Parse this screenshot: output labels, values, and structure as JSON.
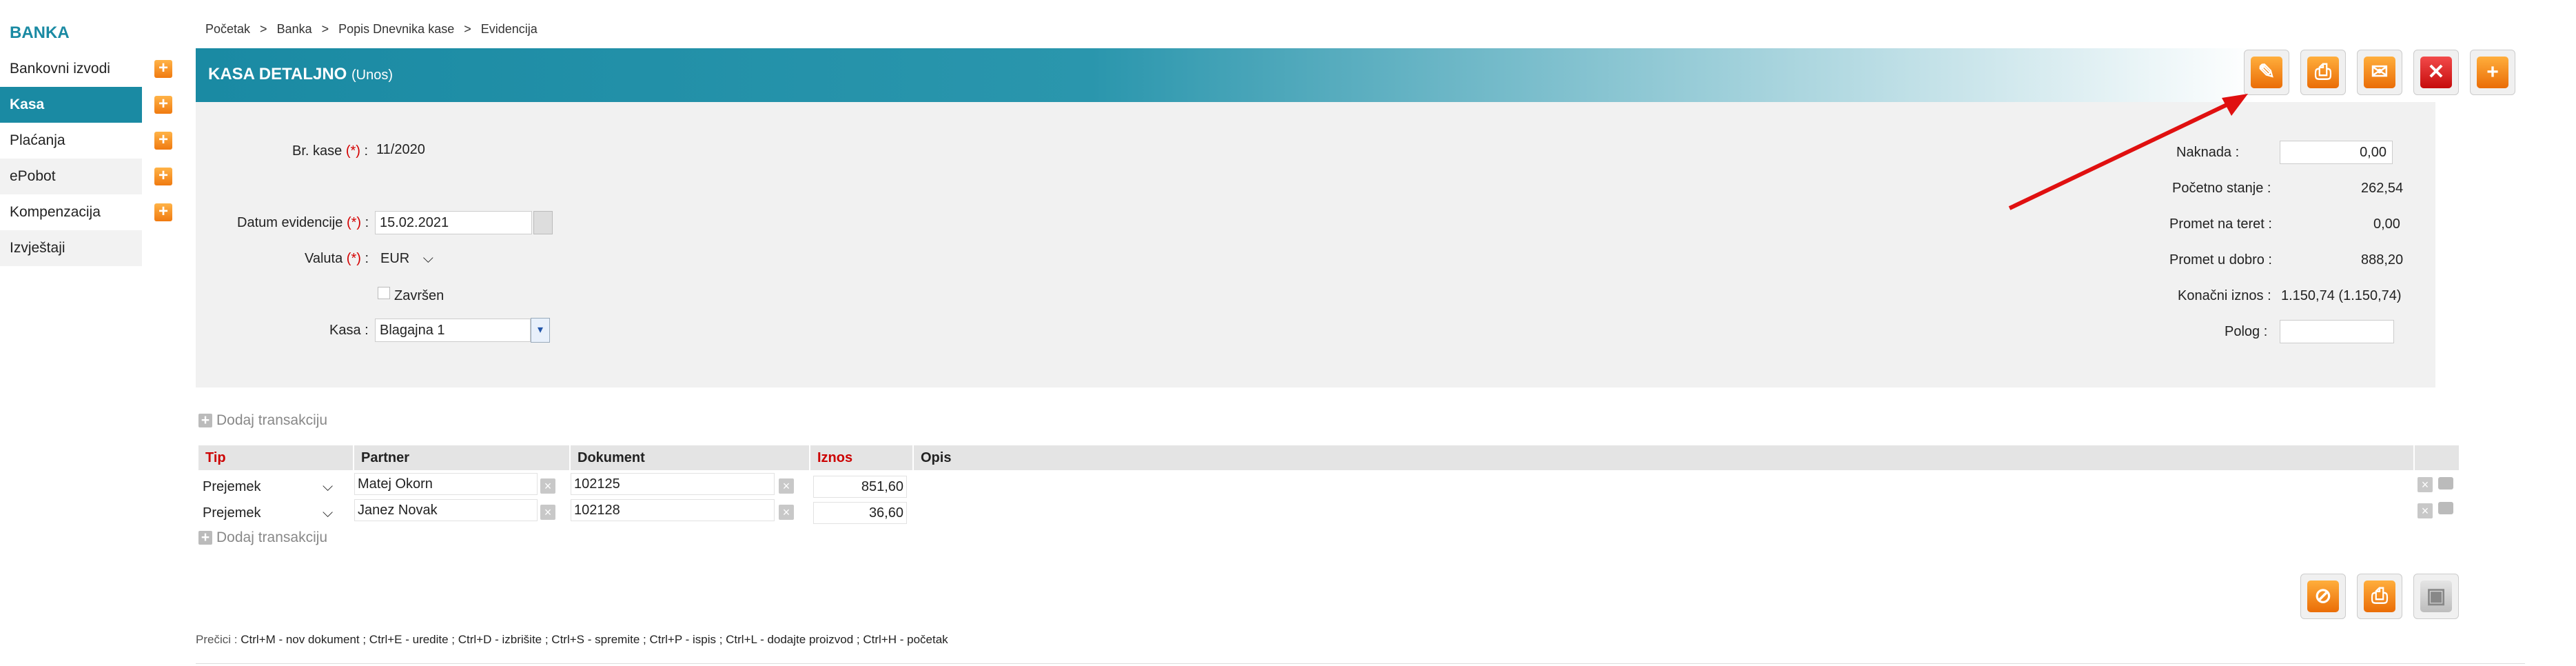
{
  "sidebar": {
    "brand": "BANKA",
    "items": [
      {
        "label": "Bankovni izvodi",
        "has_add": true
      },
      {
        "label": "Kasa",
        "has_add": true,
        "active": true
      },
      {
        "label": "Plaćanja",
        "has_add": true
      },
      {
        "label": "ePobot",
        "has_add": true
      },
      {
        "label": "Kompenzacija",
        "has_add": true
      },
      {
        "label": "Izvještaji",
        "has_add": false
      }
    ]
  },
  "breadcrumb": [
    "Početak",
    "Banka",
    "Popis Dnevnika kase",
    "Evidencija"
  ],
  "breadcrumb_sep": ">",
  "header": {
    "title": "KASA DETALJNO",
    "subtitle": "(Unos)"
  },
  "toolbar_icons": [
    "edit-icon",
    "print-icon",
    "mail-icon",
    "close-icon",
    "add-icon"
  ],
  "form": {
    "br_kase_label": "Br. kase",
    "br_kase_value": "11/2020",
    "datum_label": "Datum evidencije",
    "datum_value": "15.02.2021",
    "valuta_label": "Valuta",
    "valuta_value": "EUR",
    "zavrsen_label": "Završen",
    "kasa_label": "Kasa :",
    "kasa_value": "Blagajna 1",
    "req_mark": "(*)",
    "colon": ":"
  },
  "summary": {
    "naknada_label": "Naknada :",
    "naknada_value": "0,00",
    "pocetno_label": "Početno stanje :",
    "pocetno_value": "262,54",
    "teret_label": "Promet na teret :",
    "teret_value": "0,00",
    "dobro_label": "Promet u dobro :",
    "dobro_value": "888,20",
    "konacni_label": "Konačni iznos :",
    "konacni_value": "1.150,74 (1.150,74)",
    "polog_label": "Polog :",
    "polog_value": ""
  },
  "add_transaction": "Dodaj transakciju",
  "table": {
    "headers": [
      "Tip",
      "Partner",
      "Dokument",
      "Iznos",
      "Opis"
    ],
    "rows": [
      {
        "tip": "Prejemek",
        "partner": "Matej Okorn",
        "dokument": "102125",
        "iznos": "851,60",
        "opis": ""
      },
      {
        "tip": "Prejemek",
        "partner": "Janez Novak",
        "dokument": "102128",
        "iznos": "36,60",
        "opis": ""
      }
    ]
  },
  "bottom_icons": [
    "cancel-icon",
    "print-icon",
    "save-icon"
  ],
  "shortcuts": {
    "label": "Prečici :",
    "text": "Ctrl+M - nov dokument ;  Ctrl+E - uredite ;  Ctrl+D - izbrišite ;  Ctrl+S - spremite ;  Ctrl+P - ispis ;  Ctrl+L - dodajte proizvod ;  Ctrl+H - početak"
  },
  "colors": {
    "accent": "#1a8aa3",
    "orange": "#f07a10",
    "required": "#d40000",
    "arrow": "#e01010"
  }
}
